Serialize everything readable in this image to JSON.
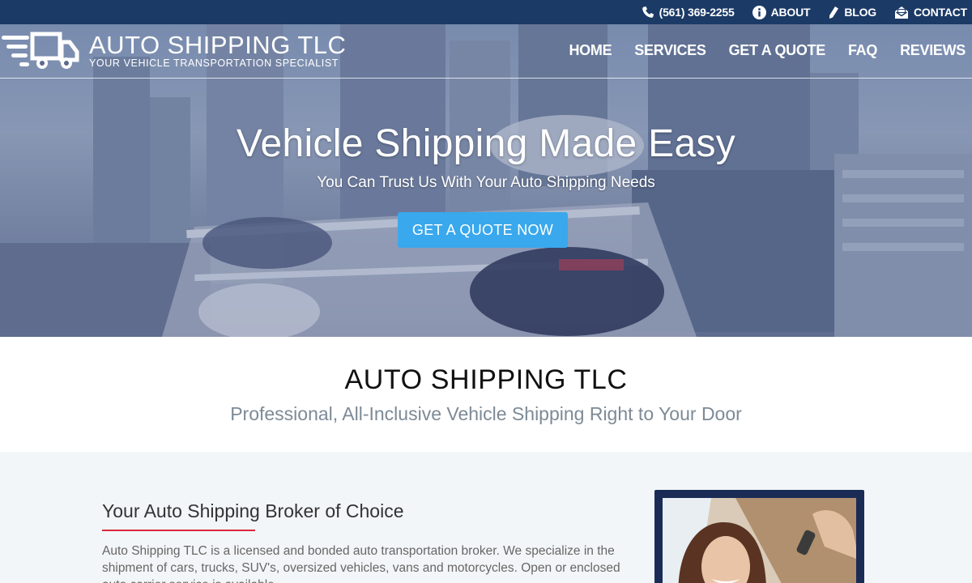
{
  "topbar": {
    "phone": "(561) 369-2255",
    "about": "ABOUT",
    "blog": "BLOG",
    "contact": "CONTACT"
  },
  "logo": {
    "title": "AUTO SHIPPING TLC",
    "tagline": "YOUR VEHICLE TRANSPORTATION SPECIALIST"
  },
  "nav": {
    "items": [
      "HOME",
      "SERVICES",
      "GET A QUOTE",
      "FAQ",
      "REVIEWS"
    ]
  },
  "hero": {
    "headline": "Vehicle Shipping Made Easy",
    "subheadline": "You Can Trust Us With Your Auto Shipping Needs",
    "cta": "GET A QUOTE NOW"
  },
  "intro": {
    "title": "AUTO SHIPPING TLC",
    "subtitle": "Professional, All-Inclusive Vehicle Shipping Right to Your Door"
  },
  "content": {
    "heading": "Your Auto Shipping Broker of Choice",
    "body": "Auto Shipping TLC is a licensed and bonded auto transportation broker. We specialize in the shipment of cars, trucks, SUV's, oversized vehicles, vans and motorcycles. Open or enclosed auto carrier service is available."
  },
  "colors": {
    "topbar": "#1b3a66",
    "cta": "#3aa8ec",
    "accent_rule": "#d9283b",
    "photo_frame": "#1a2c55"
  },
  "icons": {
    "phone": "phone-icon",
    "about": "info-icon",
    "blog": "pencil-icon",
    "contact": "envelope-icon",
    "logo": "speeding-truck-icon"
  }
}
